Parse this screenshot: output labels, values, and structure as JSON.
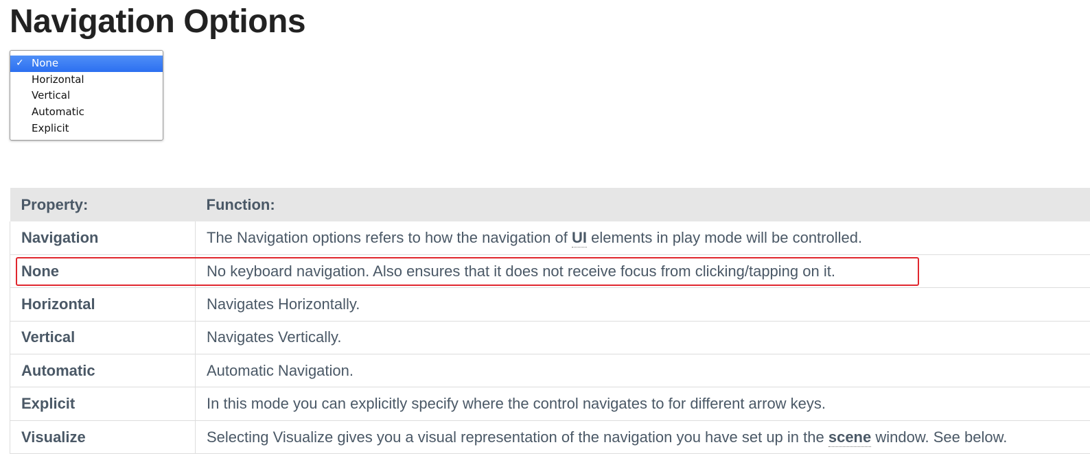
{
  "title": "Navigation Options",
  "dropdown": {
    "selected_mark": "✓",
    "options": [
      "None",
      "Horizontal",
      "Vertical",
      "Automatic",
      "Explicit"
    ],
    "selected": "None"
  },
  "table": {
    "headers": [
      "Property:",
      "Function:"
    ],
    "rows": [
      {
        "property": "Navigation",
        "function_before": "The Navigation options refers to how the navigation of ",
        "function_term": "UI",
        "function_after": " elements in play mode will be controlled."
      },
      {
        "property": "None",
        "function": "No keyboard navigation. Also ensures that it does not receive focus from clicking/tapping on it."
      },
      {
        "property": "Horizontal",
        "function": "Navigates Horizontally."
      },
      {
        "property": "Vertical",
        "function": "Navigates Vertically."
      },
      {
        "property": "Automatic",
        "function": "Automatic Navigation."
      },
      {
        "property": "Explicit",
        "function": "In this mode you can explicitly specify where the control navigates to for different arrow keys."
      },
      {
        "property": "Visualize",
        "function_before": "Selecting Visualize gives you a visual representation of the navigation you have set up in the ",
        "function_term": "scene",
        "function_after": " window. See below."
      }
    ]
  },
  "colors": {
    "highlight_border": "#e0262d",
    "selected_option": "#2c6ff0",
    "header_bg": "#e6e6e6"
  }
}
